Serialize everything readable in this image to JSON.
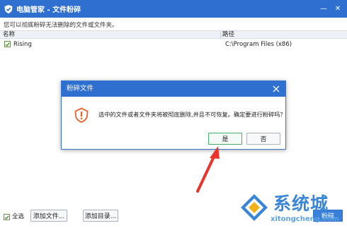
{
  "window": {
    "title": "电脑管家 - 文件粉碎",
    "minimize_glyph": "—",
    "close_glyph": "✕"
  },
  "subtitle": "您可以彻底粉碎无法删除的文件或文件夹。",
  "table": {
    "columns": [
      "名称",
      "路径"
    ],
    "rows": [
      {
        "checked": true,
        "name": "Rising",
        "path": "C:\\Program Files (x86)"
      }
    ]
  },
  "dialog": {
    "title": "粉碎文件",
    "message": "选中的文件或者文件夹将被彻底删除,并且不可恢复。确定要进行粉碎吗？",
    "yes_label": "是",
    "no_label": "否",
    "icon": "warning-icon"
  },
  "bottom": {
    "select_all_checked": true,
    "select_all_label": "全选",
    "add_file_label": "添加文件...",
    "add_dir_label": "添加目录...",
    "shred_label": "粉碎"
  },
  "watermark": {
    "brand": "系统城",
    "url": "xitongcheng.com"
  },
  "colors": {
    "titlebar": "#2f6fd0",
    "accent_green": "#42b06a",
    "warning": "#e8622a",
    "arrow": "#e8342a"
  }
}
